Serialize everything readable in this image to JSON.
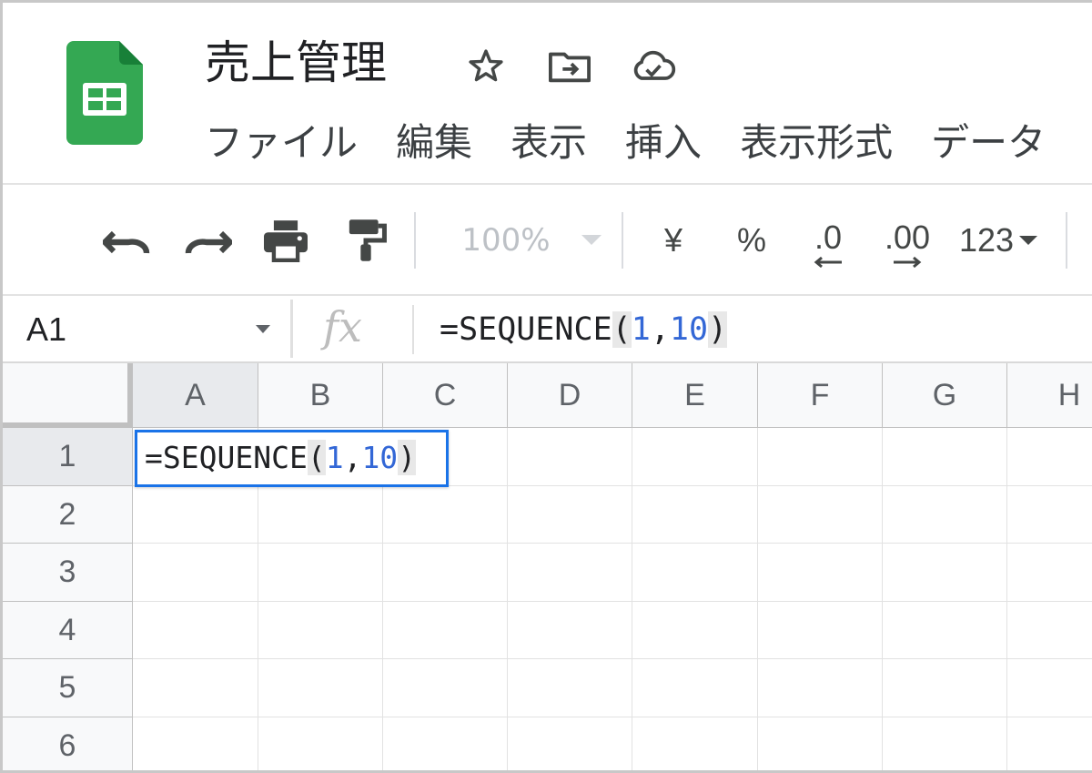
{
  "doc": {
    "title": "売上管理",
    "brand_color": "#34a853"
  },
  "title_icons": [
    "star-icon",
    "move-to-folder-icon",
    "cloud-saved-icon"
  ],
  "menu": [
    "ファイル",
    "編集",
    "表示",
    "挿入",
    "表示形式",
    "データ"
  ],
  "toolbar": {
    "zoom": "100%",
    "currency": "¥",
    "percent": "%",
    "dec_decrease": ".0",
    "dec_increase": ".00",
    "number_format": "123"
  },
  "formula_bar": {
    "cell_ref": "A1",
    "fx": "fx",
    "formula_prefix": "=SEQUENCE",
    "open_paren": "(",
    "arg1": "1",
    "comma": ",",
    "arg2": "10",
    "close_paren": ")"
  },
  "grid": {
    "columns": [
      "A",
      "B",
      "C",
      "D",
      "E",
      "F",
      "G",
      "H"
    ],
    "rows": [
      "1",
      "2",
      "3",
      "4",
      "5",
      "6"
    ],
    "active_cell": "A1",
    "accent": "#1a73e8"
  }
}
